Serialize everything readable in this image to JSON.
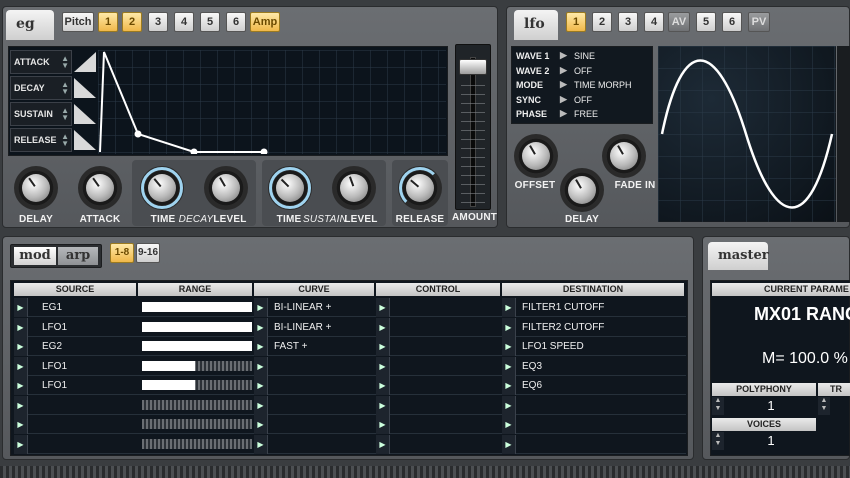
{
  "eg": {
    "tab_label": "eg",
    "buttons": [
      {
        "label": "Pitch",
        "on": false
      },
      {
        "label": "1",
        "on": true
      },
      {
        "label": "2",
        "on": true
      },
      {
        "label": "3",
        "on": false
      },
      {
        "label": "4",
        "on": false
      },
      {
        "label": "5",
        "on": false
      },
      {
        "label": "6",
        "on": false
      },
      {
        "label": "Amp",
        "on": true
      }
    ],
    "env_rows": [
      "ATTACK",
      "DECAY",
      "SUSTAIN",
      "RELEASE"
    ],
    "knobs": {
      "delay": "DELAY",
      "attack": "ATTACK",
      "time1": "TIME",
      "decay_italic": "DECAY",
      "level1": "LEVEL",
      "time2": "TIME",
      "sustain_italic": "SUSTAIN",
      "level2": "LEVEL",
      "release": "RELEASE",
      "amount": "AMOUNT"
    }
  },
  "lfo": {
    "tab_label": "lfo",
    "buttons": [
      "1",
      "2",
      "3",
      "4",
      "AV",
      "5",
      "6",
      "PV"
    ],
    "params": [
      {
        "key": "WAVE 1",
        "value": "SINE"
      },
      {
        "key": "WAVE 2",
        "value": "OFF"
      },
      {
        "key": "MODE",
        "value": "TIME MORPH"
      },
      {
        "key": "SYNC",
        "value": "OFF"
      },
      {
        "key": "PHASE",
        "value": "FREE"
      }
    ],
    "knobs": {
      "offset": "OFFSET",
      "delay": "DELAY",
      "fade_in": "FADE IN"
    }
  },
  "mod": {
    "tab_mod": "mod",
    "tab_arp": "arp",
    "page_1_8": "1-8",
    "page_9_16": "9-16",
    "headers": {
      "source": "SOURCE",
      "range": "RANGE",
      "curve": "CURVE",
      "control": "CONTROL",
      "destination": "DESTINATION"
    },
    "rows": [
      {
        "source": "EG1",
        "range": 1.0,
        "curve": "BI-LINEAR +",
        "control": "",
        "destination": "FILTER1 CUTOFF"
      },
      {
        "source": "LFO1",
        "range": 1.0,
        "curve": "BI-LINEAR +",
        "control": "",
        "destination": "FILTER2 CUTOFF"
      },
      {
        "source": "EG2",
        "range": 1.0,
        "curve": "FAST +",
        "control": "",
        "destination": "LFO1 SPEED"
      },
      {
        "source": "LFO1",
        "range": 0.48,
        "curve": "",
        "control": "",
        "destination": "EQ3"
      },
      {
        "source": "LFO1",
        "range": 0.48,
        "curve": "",
        "control": "",
        "destination": "EQ6"
      },
      {
        "source": "",
        "range": 0,
        "curve": "",
        "control": "",
        "destination": ""
      },
      {
        "source": "",
        "range": 0,
        "curve": "",
        "control": "",
        "destination": ""
      },
      {
        "source": "",
        "range": 0,
        "curve": "",
        "control": "",
        "destination": ""
      }
    ]
  },
  "master": {
    "tab_label": "master",
    "current_param_label": "CURRENT PARAME",
    "current_param_value": "MX01 RANG",
    "param_readout": "M= 100.0 %",
    "polyphony_label": "POLYPHONY",
    "polyphony_value": "1",
    "voices_label": "VOICES",
    "voices_value": "1",
    "tr_label": "TR"
  }
}
